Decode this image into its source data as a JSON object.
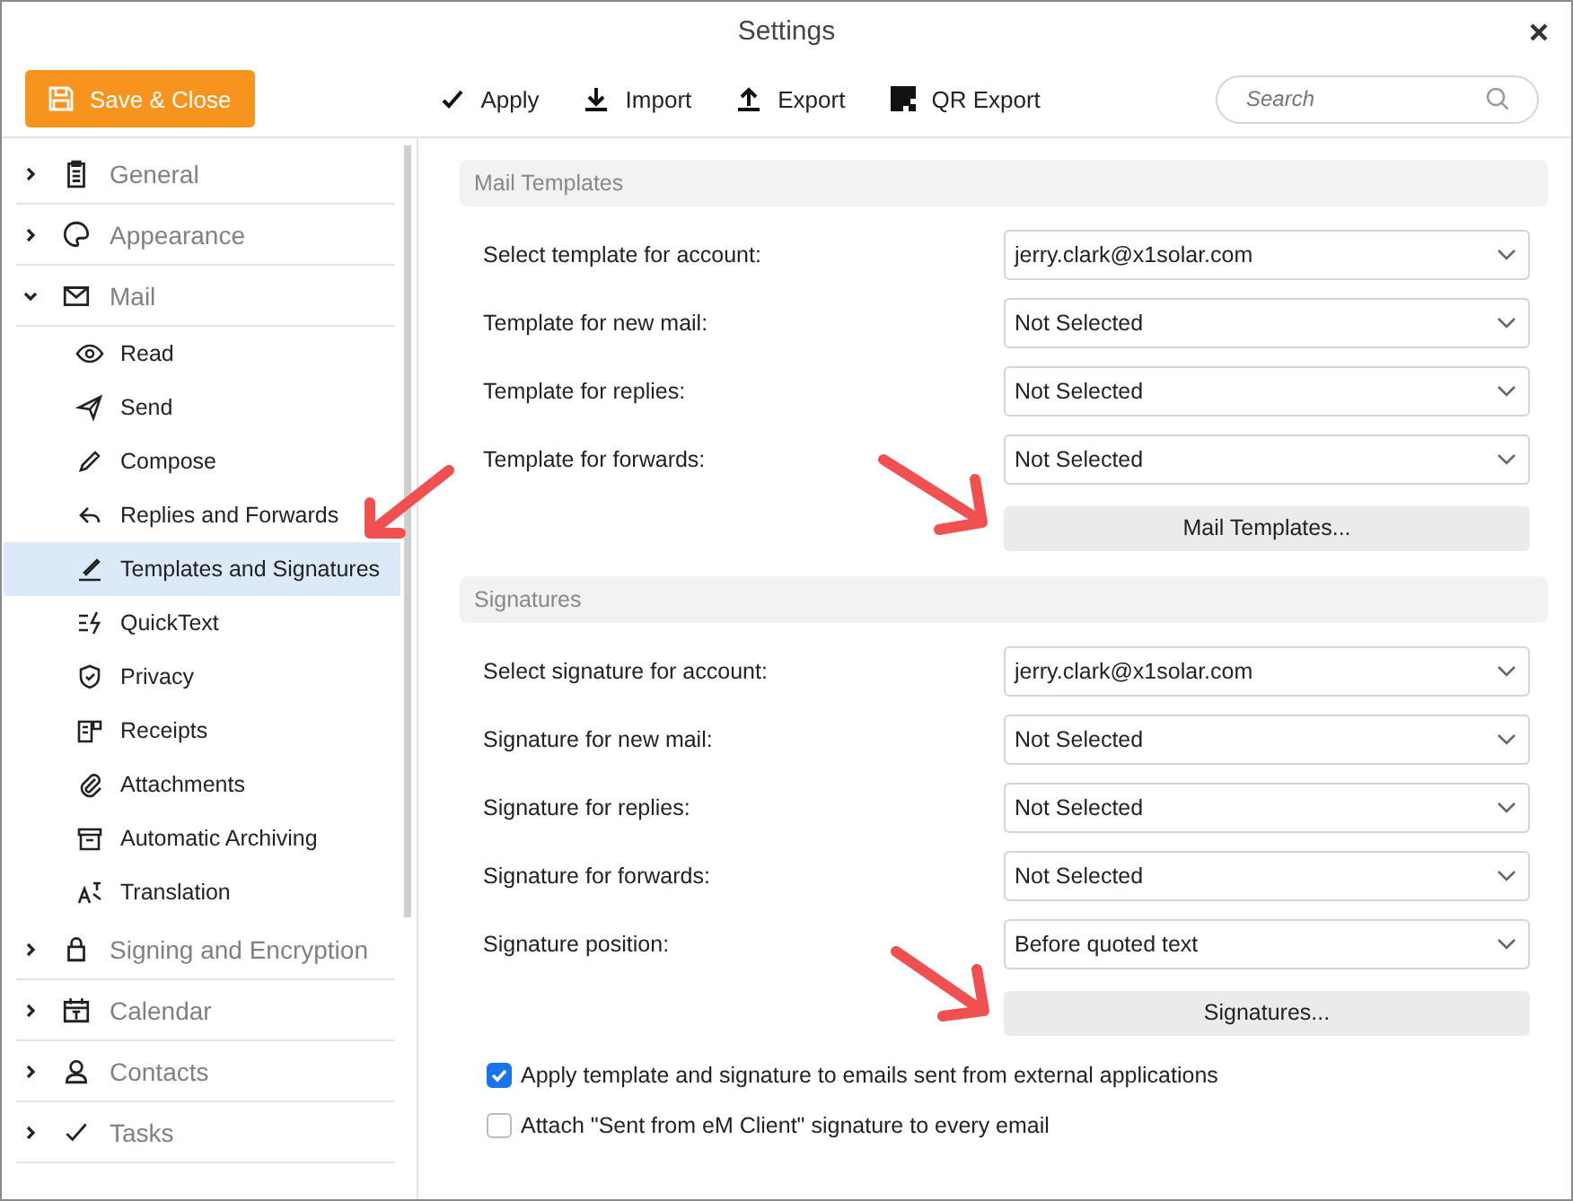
{
  "window": {
    "title": "Settings"
  },
  "toolbar": {
    "save_button": "Save & Close",
    "actions": [
      "Apply",
      "Import",
      "Export",
      "QR Export"
    ],
    "search": {
      "placeholder": "Search"
    }
  },
  "sidebar": {
    "groups": [
      {
        "label": "General",
        "expanded": false
      },
      {
        "label": "Appearance",
        "expanded": false
      },
      {
        "label": "Mail",
        "expanded": true,
        "children": [
          {
            "label": "Read",
            "selected": false
          },
          {
            "label": "Send",
            "selected": false
          },
          {
            "label": "Compose",
            "selected": false
          },
          {
            "label": "Replies and Forwards",
            "selected": false
          },
          {
            "label": "Templates and Signatures",
            "selected": true
          },
          {
            "label": "QuickText",
            "selected": false
          },
          {
            "label": "Privacy",
            "selected": false
          },
          {
            "label": "Receipts",
            "selected": false
          },
          {
            "label": "Attachments",
            "selected": false
          },
          {
            "label": "Automatic Archiving",
            "selected": false
          },
          {
            "label": "Translation",
            "selected": false
          }
        ]
      },
      {
        "label": "Signing and Encryption",
        "expanded": false
      },
      {
        "label": "Calendar",
        "expanded": false
      },
      {
        "label": "Contacts",
        "expanded": false
      },
      {
        "label": "Tasks",
        "expanded": false
      }
    ]
  },
  "sections": [
    {
      "title": "Mail Templates",
      "fields": [
        {
          "label": "Select template for account:",
          "value": "jerry.clark@x1solar.com"
        },
        {
          "label": "Template for new mail:",
          "value": "Not Selected"
        },
        {
          "label": "Template for replies:",
          "value": "Not Selected"
        },
        {
          "label": "Template for forwards:",
          "value": "Not Selected"
        }
      ],
      "button": "Mail Templates..."
    },
    {
      "title": "Signatures",
      "fields": [
        {
          "label": "Select signature for account:",
          "value": "jerry.clark@x1solar.com"
        },
        {
          "label": "Signature for new mail:",
          "value": "Not Selected"
        },
        {
          "label": "Signature for replies:",
          "value": "Not Selected"
        },
        {
          "label": "Signature for forwards:",
          "value": "Not Selected"
        },
        {
          "label": "Signature position:",
          "value": "Before quoted text"
        }
      ],
      "button": "Signatures..."
    }
  ],
  "options": [
    {
      "label": "Apply template and signature to emails sent from external applications",
      "checked": true
    },
    {
      "label": "Attach \"Sent from eM Client\" signature to every email",
      "checked": false
    }
  ]
}
